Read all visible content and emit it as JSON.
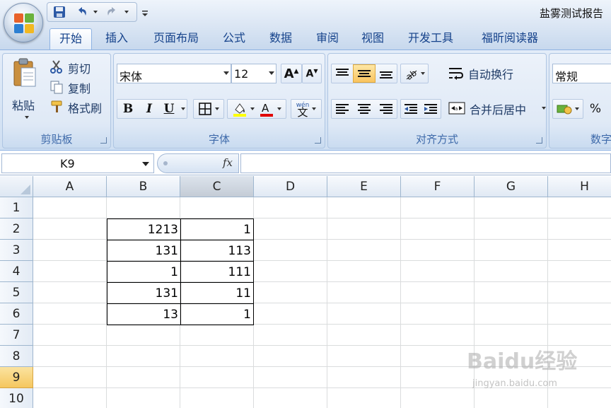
{
  "title_bar": {
    "doc_title": "盐雾测试报告"
  },
  "tabs": [
    "开始",
    "插入",
    "页面布局",
    "公式",
    "数据",
    "审阅",
    "视图",
    "开发工具",
    "福昕阅读器"
  ],
  "ribbon": {
    "clipboard": {
      "paste": "粘贴",
      "cut": "剪切",
      "copy": "复制",
      "format_painter": "格式刷",
      "label": "剪贴板"
    },
    "font": {
      "name": "宋体",
      "size": "12",
      "bold": "B",
      "italic": "I",
      "underline": "U",
      "label": "字体",
      "phonetic": "wén"
    },
    "alignment": {
      "wrap": "自动换行",
      "merge": "合并后居中",
      "label": "对齐方式"
    },
    "number": {
      "format": "常规",
      "percent": "%",
      "label": "数字"
    }
  },
  "formula_bar": {
    "name_box": "K9",
    "fx": "fx",
    "formula": ""
  },
  "sheet": {
    "columns": [
      "A",
      "B",
      "C",
      "D",
      "E",
      "F",
      "G",
      "H"
    ],
    "rows": [
      "1",
      "2",
      "3",
      "4",
      "5",
      "6",
      "7",
      "8",
      "9",
      "10"
    ],
    "selected_column": "C",
    "selected_row": "9",
    "cells": {
      "B2": "1213",
      "C2": "1",
      "B3": "131",
      "C3": "113",
      "B4": "1",
      "C4": "111",
      "B5": "131",
      "C5": "11",
      "B6": "13",
      "C6": "1"
    }
  },
  "watermark": {
    "brand": "Baidu经验",
    "url": "jingyan.baidu.com"
  },
  "colors": {
    "accent": "#15428b",
    "ribbon": "#dfe9f6",
    "selected_header": "#f5c75f",
    "gridline": "#dadcdd"
  }
}
